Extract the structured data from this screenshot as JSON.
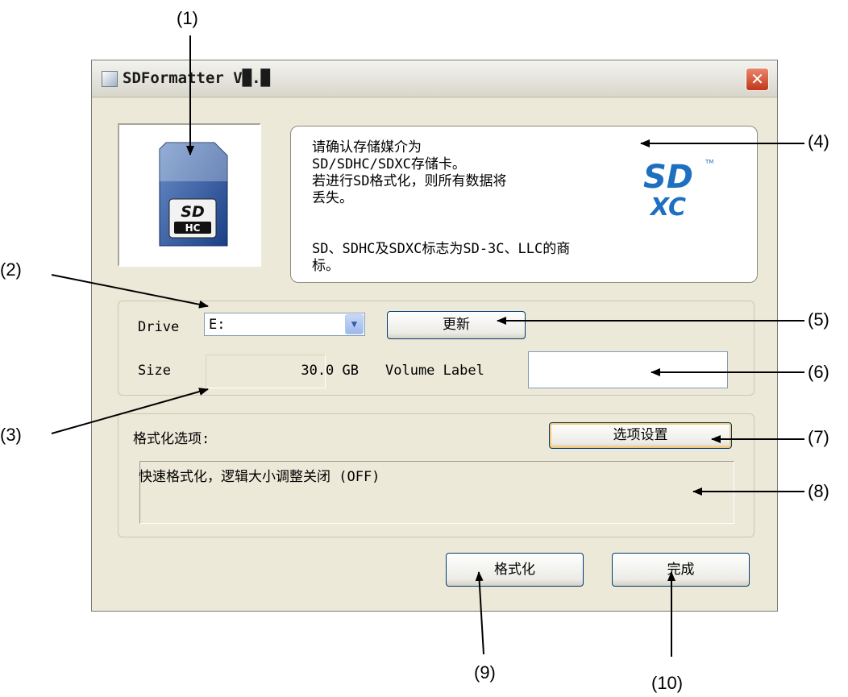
{
  "window": {
    "title": "SDFormatter V█.█",
    "close_glyph": "✕"
  },
  "sd_card": {
    "logo_top": "SD",
    "logo_bottom": "HC"
  },
  "info": {
    "message_lines": [
      "请确认存储媒介为",
      "SD/SDHC/SDXC存储卡。",
      "若进行SD格式化，则所有数据将",
      "丢失。"
    ],
    "trademark_lines": [
      "SD、SDHC及SDXC标志为SD-3C、LLC的商",
      "标。"
    ],
    "logo_top": "SD",
    "logo_bottom": "XC",
    "logo_tm": "TM"
  },
  "drive": {
    "label": "Drive",
    "selected": "E:",
    "refresh_label": "更新",
    "size_label": "Size",
    "size_value": "30.0 GB",
    "volume_label": "Volume Label",
    "volume_value": ""
  },
  "format_options": {
    "label": "格式化选项:",
    "settings_button": "选项设置",
    "summary": "快速格式化，逻辑大小调整关闭 (OFF)"
  },
  "actions": {
    "format_button": "格式化",
    "exit_button": "完成"
  },
  "callouts": [
    "(1)",
    "(2)",
    "(3)",
    "(4)",
    "(5)",
    "(6)",
    "(7)",
    "(8)",
    "(9)",
    "(10)"
  ],
  "icons": {
    "app": "app-icon",
    "close": "close-icon",
    "dropdown": "chevron-down-icon",
    "sd_card": "sd-card-icon",
    "sdxc": "sdxc-logo"
  }
}
